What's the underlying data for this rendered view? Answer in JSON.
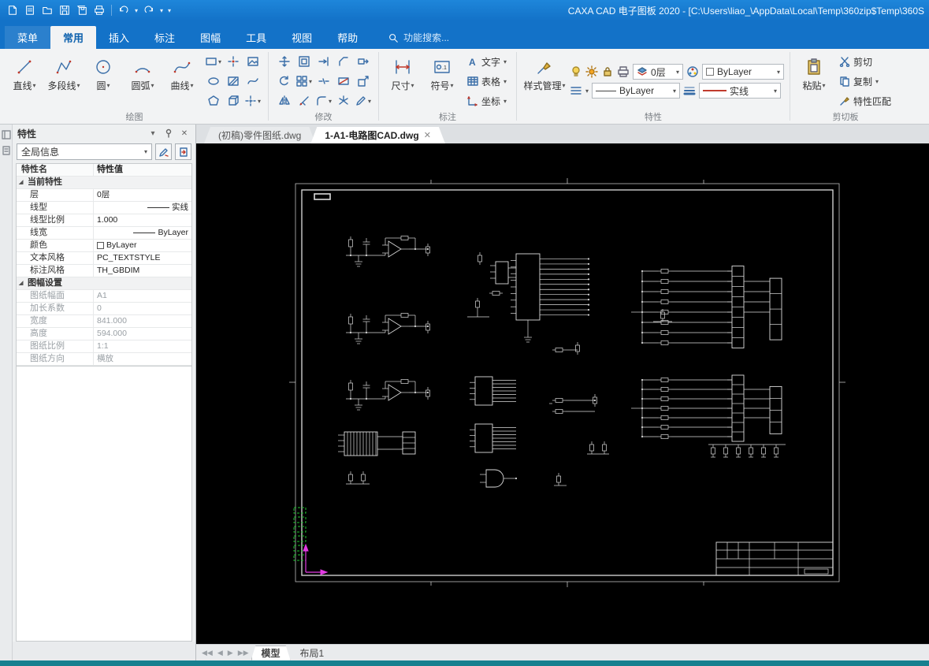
{
  "window": {
    "title": "CAXA CAD 电子图板 2020 - [C:\\Users\\liao_\\AppData\\Local\\Temp\\360zip$Temp\\360S"
  },
  "menu": {
    "items": [
      "菜单",
      "常用",
      "插入",
      "标注",
      "图幅",
      "工具",
      "视图",
      "帮助"
    ],
    "active": "常用",
    "search": "功能搜索..."
  },
  "ribbon": {
    "draw": {
      "label": "绘图",
      "big": [
        "直线",
        "多段线",
        "圆",
        "圆弧",
        "曲线"
      ]
    },
    "modify": {
      "label": "修改"
    },
    "dim": {
      "label": "标注",
      "big": [
        "尺寸",
        "符号"
      ],
      "small": [
        "文字",
        "表格",
        "坐标"
      ]
    },
    "props": {
      "label": "特性",
      "manager": "样式管理",
      "layer": "0层",
      "color": "ByLayer",
      "linetype": "ByLayer",
      "lineweight": "实线"
    },
    "clip": {
      "label": "剪切板",
      "paste": "粘贴",
      "items": [
        "剪切",
        "复制",
        "特性匹配"
      ]
    }
  },
  "panel": {
    "title": "特性",
    "combo": "全局信息",
    "header": {
      "name": "特性名",
      "value": "特性值"
    },
    "rows": [
      {
        "name": "当前特性",
        "value": ""
      },
      {
        "name": "层",
        "value": "0层"
      },
      {
        "name": "线型",
        "value": "实线"
      },
      {
        "name": "线型比例",
        "value": "1.000"
      },
      {
        "name": "线宽",
        "value": "ByLayer"
      },
      {
        "name": "颜色",
        "value": "ByLayer"
      },
      {
        "name": "文本风格",
        "value": "PC_TEXTSTYLE"
      },
      {
        "name": "标注风格",
        "value": "TH_GBDIM"
      },
      {
        "name": "图幅设置",
        "value": ""
      },
      {
        "name": "图纸幅面",
        "value": "A1"
      },
      {
        "name": "加长系数",
        "value": "0"
      },
      {
        "name": "宽度",
        "value": "841.000"
      },
      {
        "name": "高度",
        "value": "594.000"
      },
      {
        "name": "图纸比例",
        "value": "1:1"
      },
      {
        "name": "图纸方向",
        "value": "横放"
      }
    ]
  },
  "doctabs": [
    "(初稿)零件图纸.dwg",
    "1-A1-电路图CAD.dwg"
  ],
  "bottomtabs": {
    "model": "模型",
    "layout": "布局1"
  },
  "colors": {
    "titlebar": "#1372c8",
    "accent": "#0f62ae",
    "canvas_bg": "#000000",
    "schematic": "#dcdcdc",
    "ucs": "#e23ae2",
    "blocks": "#1ec32e",
    "status_strip": "#17808f"
  }
}
